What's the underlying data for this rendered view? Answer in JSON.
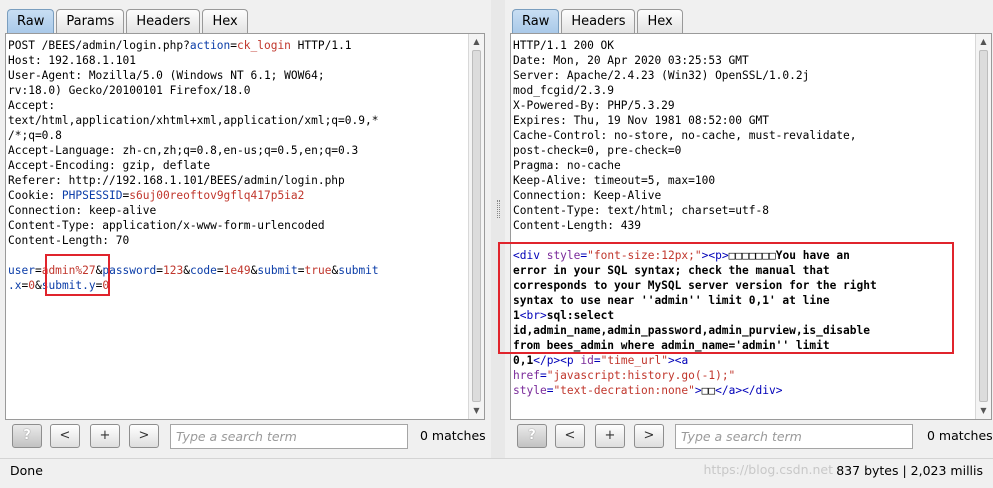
{
  "tabs_left": [
    "Raw",
    "Params",
    "Headers",
    "Hex"
  ],
  "tabs_right": [
    "Raw",
    "Headers",
    "Hex"
  ],
  "active_tab": "Raw",
  "request": {
    "l0": {
      "method": "POST /BEES/admin/login.php?",
      "k1": "action",
      "eq": "=",
      "v1": "ck_login",
      "rest": " HTTP/1.1"
    },
    "l1": "Host: 192.168.1.101",
    "l2": "User-Agent: Mozilla/5.0 (Windows NT 6.1; WOW64;",
    "l3": "rv:18.0) Gecko/20100101 Firefox/18.0",
    "l4": "Accept:",
    "l5": "text/html,application/xhtml+xml,application/xml;q=0.9,*",
    "l6": "/*;q=0.8",
    "l7": "Accept-Language: zh-cn,zh;q=0.8,en-us;q=0.5,en;q=0.3",
    "l8": "Accept-Encoding: gzip, deflate",
    "l9": "Referer: http://192.168.1.101/BEES/admin/login.php",
    "l10": {
      "prefix": "Cookie: ",
      "key": "PHPSESSID",
      "eq": "=",
      "val": "s6uj00reoftov9gflq417p5ia2"
    },
    "l11": "Connection: keep-alive",
    "l12": "Content-Type: application/x-www-form-urlencoded",
    "l13": "Content-Length: 70",
    "body1": {
      "k1": "user",
      "v1": "admin%27",
      "k2": "password",
      "v2": "123",
      "k3": "code",
      "v3": "1e49",
      "k4": "submit",
      "v4": "true",
      "k5": "submit"
    },
    "body2": {
      "k5b": ".x",
      "v5": "0",
      "k6": "submit.y",
      "v6": "0"
    }
  },
  "response": {
    "headers": [
      "HTTP/1.1 200 OK",
      "Date: Mon, 20 Apr 2020 03:25:53 GMT",
      "Server: Apache/2.4.23 (Win32) OpenSSL/1.0.2j",
      "mod_fcgid/2.3.9",
      "X-Powered-By: PHP/5.3.29",
      "Expires: Thu, 19 Nov 1981 08:52:00 GMT",
      "Cache-Control: no-store, no-cache, must-revalidate,",
      "post-check=0, pre-check=0",
      "Pragma: no-cache",
      "Keep-Alive: timeout=5, max=100",
      "Connection: Keep-Alive",
      "Content-Type: text/html; charset=utf-8",
      "Content-Length: 439"
    ],
    "body": {
      "div_open": "<div",
      "style_attr": "style",
      "style_val": "\"font-size:12px;\"",
      "p_open": "><p>",
      "garbled": "□□□□□□□",
      "err1": "You have an",
      "err2": "error in your SQL syntax; check the manual that",
      "err3": "corresponds to your MySQL server version for the right",
      "err4": "syntax to use near ''admin'' limit 0,1' at line",
      "err5a": "1",
      "br": "<br>",
      "err5b": "sql:select",
      "err6": "id,admin_name,admin_password,admin_purview,is_disable",
      "err7": "from bees_admin where admin_name='admin'' limit",
      "err8a": "0,1",
      "p_close": "</p>",
      "p2_open": "<p",
      "id_attr": "id",
      "id_val": "\"time_url\"",
      "a_open": "><a",
      "href_attr": "href",
      "href_val": "\"javascript:history.go(-1);\"",
      "style2_attr": "style",
      "style2_val": "\"text-decration:none\"",
      "a_text_pre": ">",
      "a_text": "□□",
      "closing": "</a></div>"
    }
  },
  "search_left": {
    "help": "?",
    "prev": "<",
    "add": "+",
    "next": ">",
    "placeholder": "Type a search term",
    "matches": "0 matches"
  },
  "search_right": {
    "help": "?",
    "prev": "<",
    "add": "+",
    "next": ">",
    "placeholder": "Type a search term",
    "matches": "0 matches"
  },
  "status": {
    "left": "Done",
    "right": "837 bytes | 2,023 millis",
    "watermark": "https://blog.csdn.net"
  }
}
